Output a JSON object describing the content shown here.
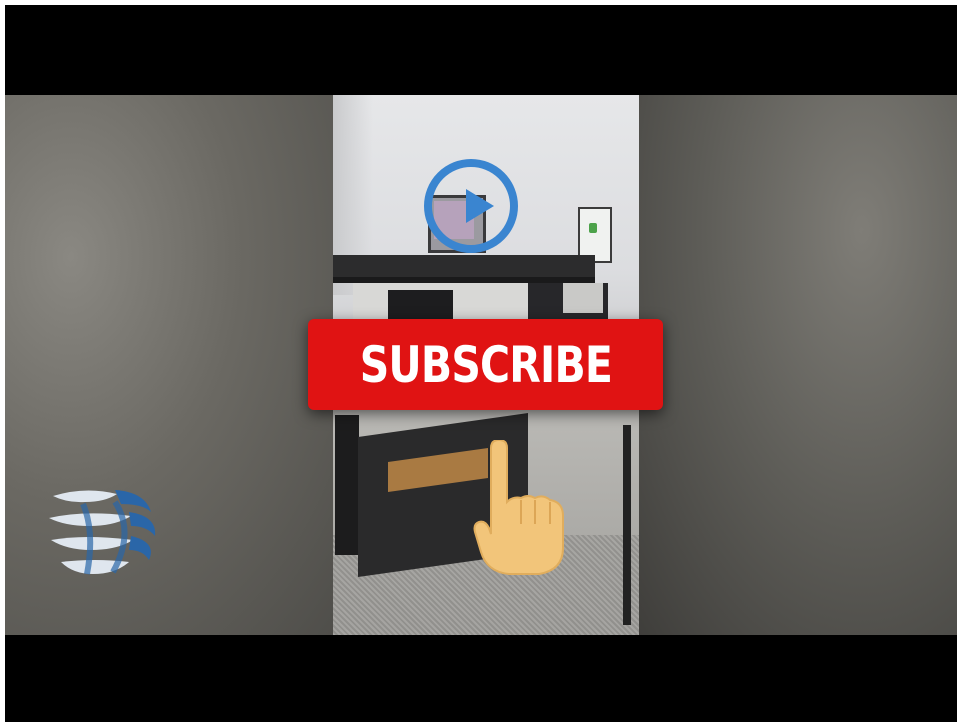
{
  "player": {
    "subscribe_label": "SUBSCRIBE"
  },
  "icons": {
    "play": "play-icon",
    "hand": "pointing-hand-icon",
    "logo": "globe-logo-icon"
  },
  "colors": {
    "subscribe_red": "#e01313",
    "play_blue": "#3a85d0",
    "hand_skin": "#f2c57a",
    "logo_blue": "#2a66a8"
  }
}
